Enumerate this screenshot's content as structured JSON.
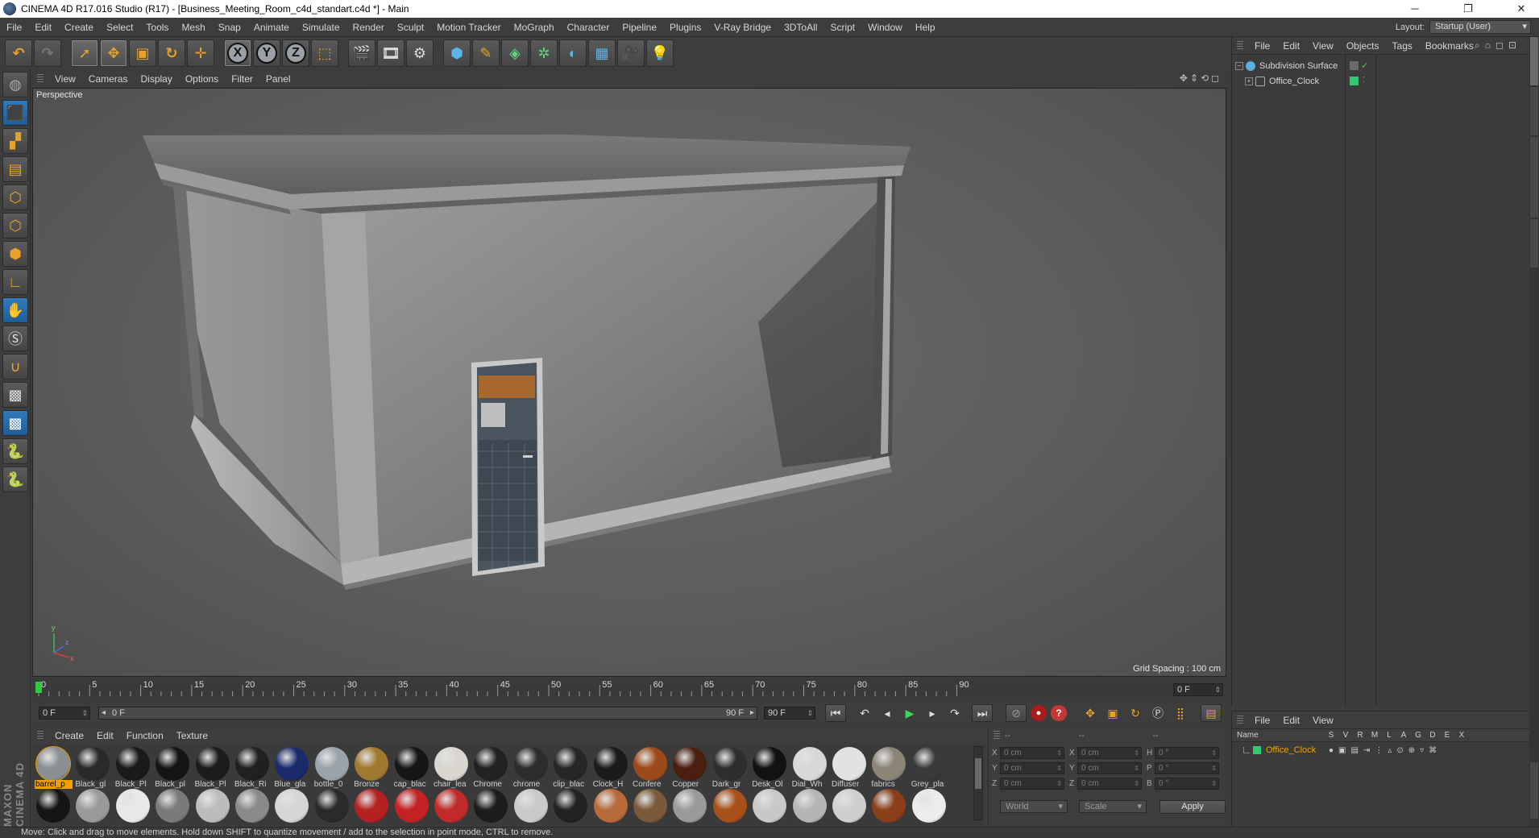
{
  "window": {
    "title": "CINEMA 4D R17.016 Studio (R17) - [Business_Meeting_Room_c4d_standart.c4d *] - Main",
    "controls": {
      "minimize": "─",
      "restore": "❐",
      "close": "✕"
    }
  },
  "menubar": {
    "items": [
      "File",
      "Edit",
      "Create",
      "Select",
      "Tools",
      "Mesh",
      "Snap",
      "Animate",
      "Simulate",
      "Render",
      "Sculpt",
      "Motion Tracker",
      "MoGraph",
      "Character",
      "Pipeline",
      "Plugins",
      "V-Ray Bridge",
      "3DToAll",
      "Script",
      "Window",
      "Help"
    ],
    "layout_label": "Layout:",
    "layout_value": "Startup (User)"
  },
  "toolbar": {
    "axis_labels": [
      "X",
      "Y",
      "Z"
    ]
  },
  "viewport": {
    "menu": [
      "View",
      "Cameras",
      "Display",
      "Options",
      "Filter",
      "Panel"
    ],
    "label": "Perspective",
    "grid_spacing": "Grid Spacing : 100 cm",
    "axis_y": "y",
    "axis_x": "x",
    "axis_z": "z"
  },
  "timeline": {
    "ticks": [
      "0",
      "5",
      "10",
      "15",
      "20",
      "25",
      "30",
      "35",
      "40",
      "45",
      "50",
      "55",
      "60",
      "65",
      "70",
      "75",
      "80",
      "85",
      "90"
    ],
    "current_frame": "0 F"
  },
  "playback": {
    "start_field": "0 F",
    "range_start": "0 F",
    "range_end": "90 F",
    "end_field": "90 F"
  },
  "materials": {
    "menu": [
      "Create",
      "Edit",
      "Function",
      "Texture"
    ],
    "row1": [
      {
        "name": "barrel_p",
        "color": "#8b8f93"
      },
      {
        "name": "Black_gl",
        "color": "#2a2a2a"
      },
      {
        "name": "Black_Pl",
        "color": "#1a1a1a"
      },
      {
        "name": "Black_pl",
        "color": "#151515"
      },
      {
        "name": "Black_Pl",
        "color": "#1c1c1c"
      },
      {
        "name": "Black_Ri",
        "color": "#202020"
      },
      {
        "name": "Blue_gla",
        "color": "#1a2a6a"
      },
      {
        "name": "bottle_0",
        "color": "#9aa2aa"
      },
      {
        "name": "Bronze",
        "color": "#a0782e"
      },
      {
        "name": "cap_blac",
        "color": "#161616"
      },
      {
        "name": "chair_lea",
        "color": "#d9d6cf"
      },
      {
        "name": "Chrome",
        "color": "#222222"
      },
      {
        "name": "chrome",
        "color": "#2d2d2d"
      },
      {
        "name": "clip_blac",
        "color": "#262626"
      },
      {
        "name": "Clock_H",
        "color": "#1b1b1b"
      },
      {
        "name": "Confere",
        "color": "#9c4a1a"
      },
      {
        "name": "Copper",
        "color": "#4a1e10"
      },
      {
        "name": "Dark_gr",
        "color": "#2e2e2e"
      },
      {
        "name": "Desk_Ol",
        "color": "#121212"
      },
      {
        "name": "Dial_Wh",
        "color": "#d8d8d8"
      },
      {
        "name": "Diffuser",
        "color": "#e2e2e2"
      },
      {
        "name": "fabrics",
        "color": "#8d8478"
      },
      {
        "name": "Grey_pla",
        "color": "#3a3a3a"
      }
    ],
    "row2": [
      {
        "color": "#151515"
      },
      {
        "color": "#9a9a9a"
      },
      {
        "color": "#e8e8e8"
      },
      {
        "color": "#7a7a7a"
      },
      {
        "color": "#bcbcbc"
      },
      {
        "color": "#8a8a8a"
      },
      {
        "color": "#d5d5d5"
      },
      {
        "color": "#2a2a2a"
      },
      {
        "color": "#b52020"
      },
      {
        "color": "#c42222"
      },
      {
        "color": "#c02a2a"
      },
      {
        "color": "#1d1d1d"
      },
      {
        "color": "#c9c9c9"
      },
      {
        "color": "#222222"
      },
      {
        "color": "#b86a3a"
      },
      {
        "color": "#7a5a3a"
      },
      {
        "color": "#9a9a9a"
      },
      {
        "color": "#a8501a"
      },
      {
        "color": "#c8c8c8"
      },
      {
        "color": "#b5b5b5"
      },
      {
        "color": "#cfcfcf"
      },
      {
        "color": "#8a3e1a"
      },
      {
        "color": "#ececec"
      }
    ]
  },
  "coordinates": {
    "header": [
      "--",
      "--",
      "--"
    ],
    "rows": [
      {
        "a1": "X",
        "v1": "0 cm",
        "a2": "X",
        "v2": "0 cm",
        "a3": "H",
        "v3": "0 °"
      },
      {
        "a1": "Y",
        "v1": "0 cm",
        "a2": "Y",
        "v2": "0 cm",
        "a3": "P",
        "v3": "0 °"
      },
      {
        "a1": "Z",
        "v1": "0 cm",
        "a2": "Z",
        "v2": "0 cm",
        "a3": "B",
        "v3": "0 °"
      }
    ],
    "mode": "World",
    "transform": "Scale",
    "apply": "Apply"
  },
  "objects": {
    "menu": [
      "File",
      "Edit",
      "View",
      "Objects",
      "Tags",
      "Bookmarks"
    ],
    "items": [
      {
        "name": "Subdivision Surface",
        "icon_color": "#5ab0e0",
        "tag_color": "#6a6a6a"
      },
      {
        "name": "Office_Clock",
        "icon_color": "#8a8a8a",
        "tag_color": "#2ecc71"
      }
    ]
  },
  "layers": {
    "menu": [
      "File",
      "Edit",
      "View"
    ],
    "columns": [
      "Name",
      "S",
      "V",
      "R",
      "M",
      "L",
      "A",
      "G",
      "D",
      "E",
      "X"
    ],
    "item": {
      "name": "Office_Clock",
      "name_color": "#f0a000",
      "swatch": "#2ecc71"
    }
  },
  "status": {
    "message": "Move: Click and drag to move elements. Hold down SHIFT to quantize movement / add to the selection in point mode, CTRL to remove."
  },
  "colors": {
    "accent_orange": "#e8a22a",
    "play_green": "#3fd55a",
    "selection_orange": "#f0a000"
  }
}
